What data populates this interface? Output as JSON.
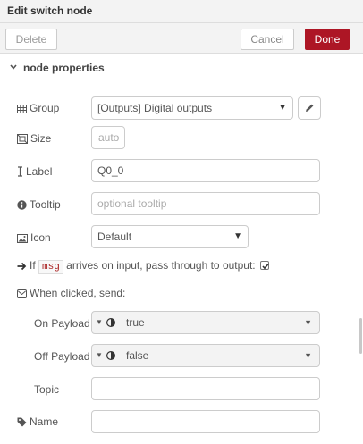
{
  "window": {
    "title": "Edit switch node"
  },
  "toolbar": {
    "delete_label": "Delete",
    "cancel_label": "Cancel",
    "done_label": "Done"
  },
  "section": {
    "title": "node properties"
  },
  "group": {
    "label": "Group",
    "value": "[Outputs] Digital outputs"
  },
  "size": {
    "label": "Size",
    "value": "auto"
  },
  "label_field": {
    "label": "Label",
    "value": "Q0_0"
  },
  "tooltip": {
    "label": "Tooltip",
    "placeholder": "optional tooltip"
  },
  "icon": {
    "label": "Icon",
    "value": "Default"
  },
  "passthrough": {
    "prefix": "If",
    "code": "msg",
    "suffix": "arrives on input, pass through to output:",
    "checked": true
  },
  "when_clicked": {
    "label": "When clicked, send:"
  },
  "on_payload": {
    "label": "On Payload",
    "value": "true"
  },
  "off_payload": {
    "label": "Off Payload",
    "value": "false"
  },
  "topic": {
    "label": "Topic",
    "value": ""
  },
  "name": {
    "label": "Name",
    "value": ""
  },
  "colors": {
    "accent": "#ad1625",
    "header_bg": "#f3f3f3",
    "border": "#cccccc"
  },
  "icons": [
    "chevron-down-icon",
    "grid-icon",
    "resize-icon",
    "text-cursor-icon",
    "info-circle-icon",
    "image-icon",
    "pencil-icon",
    "arrow-right-icon",
    "envelope-icon",
    "toggle-icon",
    "tag-icon",
    "check-icon"
  ]
}
